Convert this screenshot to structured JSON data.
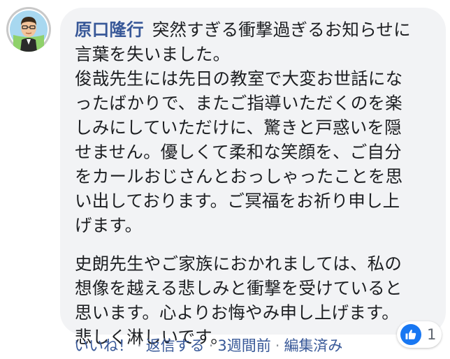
{
  "comment": {
    "author": "原口隆行",
    "paragraphs": [
      {
        "lines": [
          "突然すぎる衝撃過ぎるお知らせに",
          "言葉を失いました。",
          "俊哉先生には先日の教室で大変お世話にな",
          "ったばかりで、またご指導いただくのを楽",
          "しみにしていただけに、驚きと戸惑いを隠",
          "せません。優しくて柔和な笑顔を、ご自分",
          "をカールおじさんとおっしゃったことを思",
          "い出しております。ご冥福をお祈り申し上",
          "げます。"
        ]
      },
      {
        "lines": [
          "史朗先生やご家族におかれましては、私の",
          "想像を越える悲しみと衝撃を受けていると",
          "思います。心よりお悔やみ申し上げます。",
          "悲しく淋しいです。"
        ]
      }
    ],
    "reactions": {
      "icon": "like-icon",
      "count": "1",
      "color": "#1877f2"
    },
    "actions": {
      "like": "いいね！",
      "reply": "返信する",
      "timestamp": "3週間前",
      "edited": "編集済み",
      "separator": "·"
    }
  },
  "colors": {
    "author": "#385898",
    "bubble": "#f2f3f5",
    "text": "#1c1e21",
    "meta": "#606770"
  }
}
